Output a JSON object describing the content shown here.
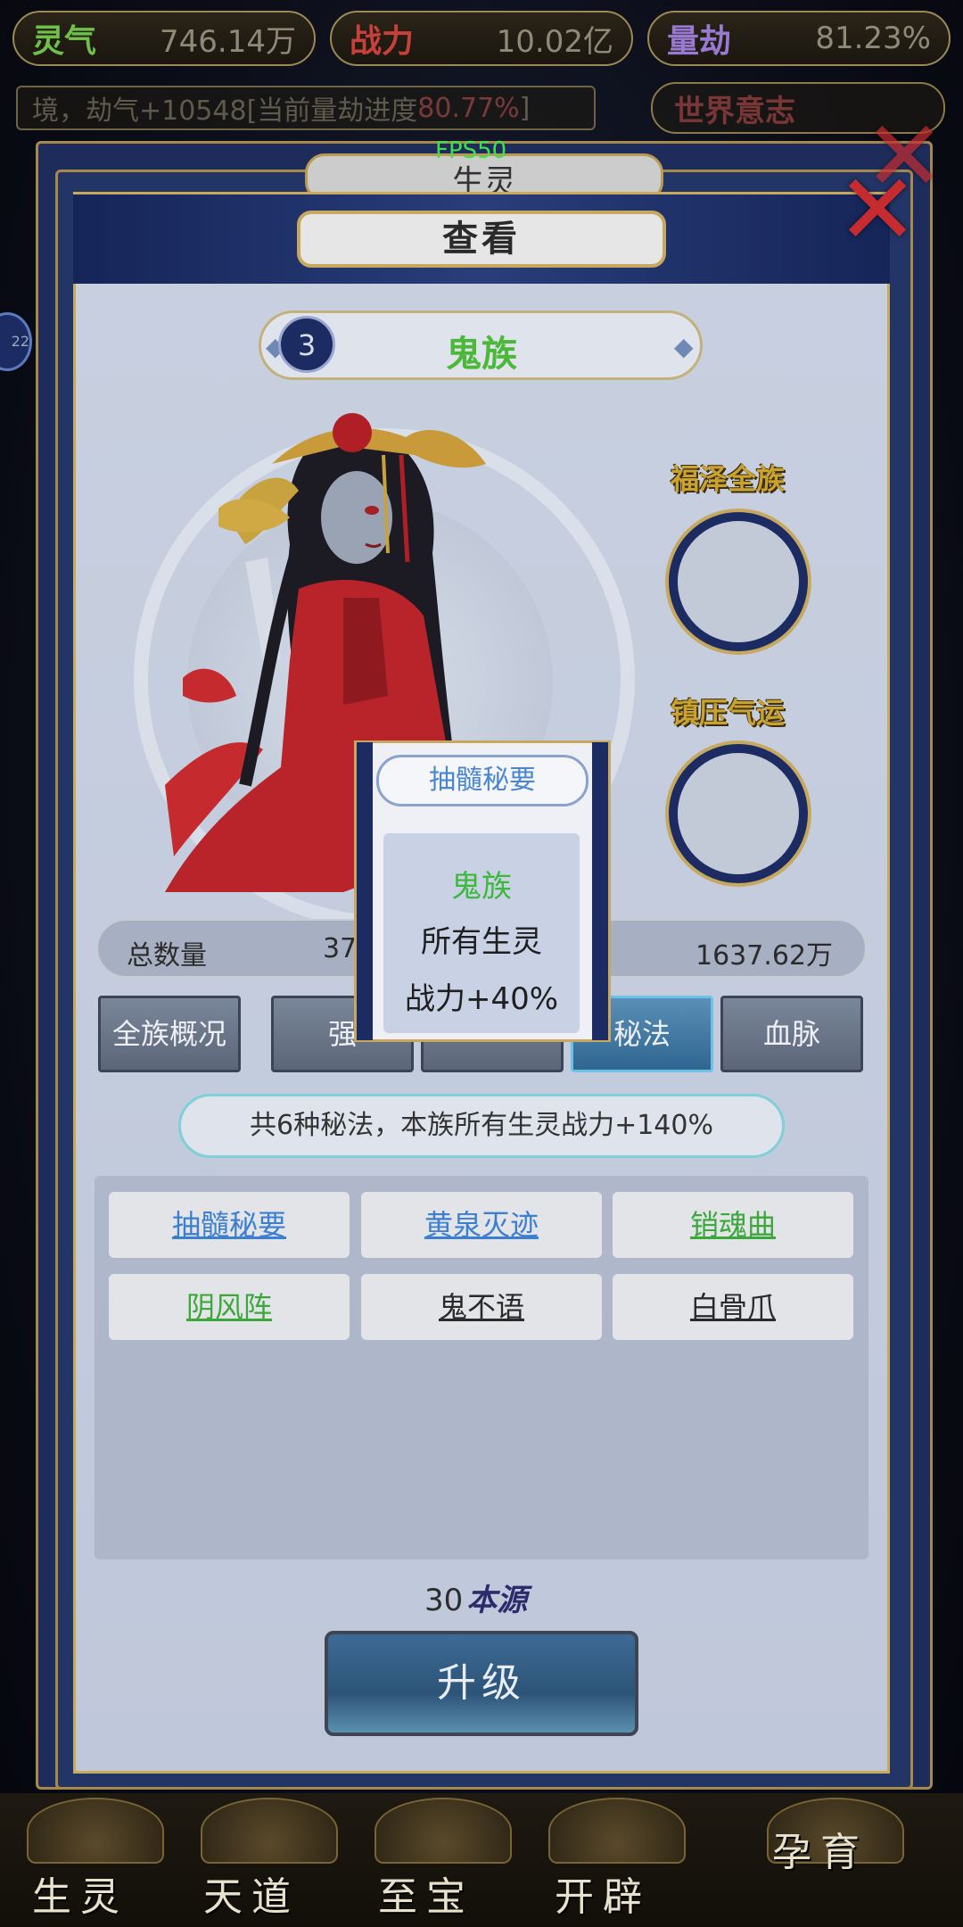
{
  "resources": [
    {
      "label": "灵气",
      "value": "746.14万",
      "color": "#6fbf4a"
    },
    {
      "label": "战力",
      "value": "10.02亿",
      "color": "#c8403a"
    },
    {
      "label": "量劫",
      "value": "81.23%",
      "color": "#9a7ad0"
    }
  ],
  "info_line": {
    "prefix": "境，劫气+10548[当前量劫进度",
    "highlight": "80.77%",
    "suffix": "]"
  },
  "world_will": "世界意志",
  "fps": "FPS50",
  "behind_tab": "生灵",
  "left_badge": "22",
  "panel_title": "查看",
  "race": {
    "number": "3",
    "name": "鬼族"
  },
  "slots": [
    {
      "title": "福泽全族"
    },
    {
      "title": "镇压气运"
    }
  ],
  "stats": {
    "label": "总数量",
    "value_partial": "37",
    "power": "1637.62万"
  },
  "subtabs": [
    "全族概况",
    "强",
    "",
    "秘法",
    "血脉"
  ],
  "summary": "共6种秘法，本族所有生灵战力+140%",
  "skills": [
    {
      "name": "抽髓秘要",
      "color": "#3c7fd0"
    },
    {
      "name": "黄泉灭迹",
      "color": "#3c7fd0"
    },
    {
      "name": "销魂曲",
      "color": "#3ca83c"
    },
    {
      "name": "阴风阵",
      "color": "#3ca83c"
    },
    {
      "name": "鬼不语",
      "color": "#2a2a2a"
    },
    {
      "name": "白骨爪",
      "color": "#2a2a2a"
    }
  ],
  "cost": {
    "amount": "30",
    "unit": "本源"
  },
  "upgrade_label": "升级",
  "popup": {
    "title": "抽髓秘要",
    "race": "鬼族",
    "line1": "所有生灵",
    "line2": "战力+40%"
  },
  "bottom_nav": [
    "生灵",
    "天道",
    "至宝",
    "开辟",
    "孕育"
  ]
}
